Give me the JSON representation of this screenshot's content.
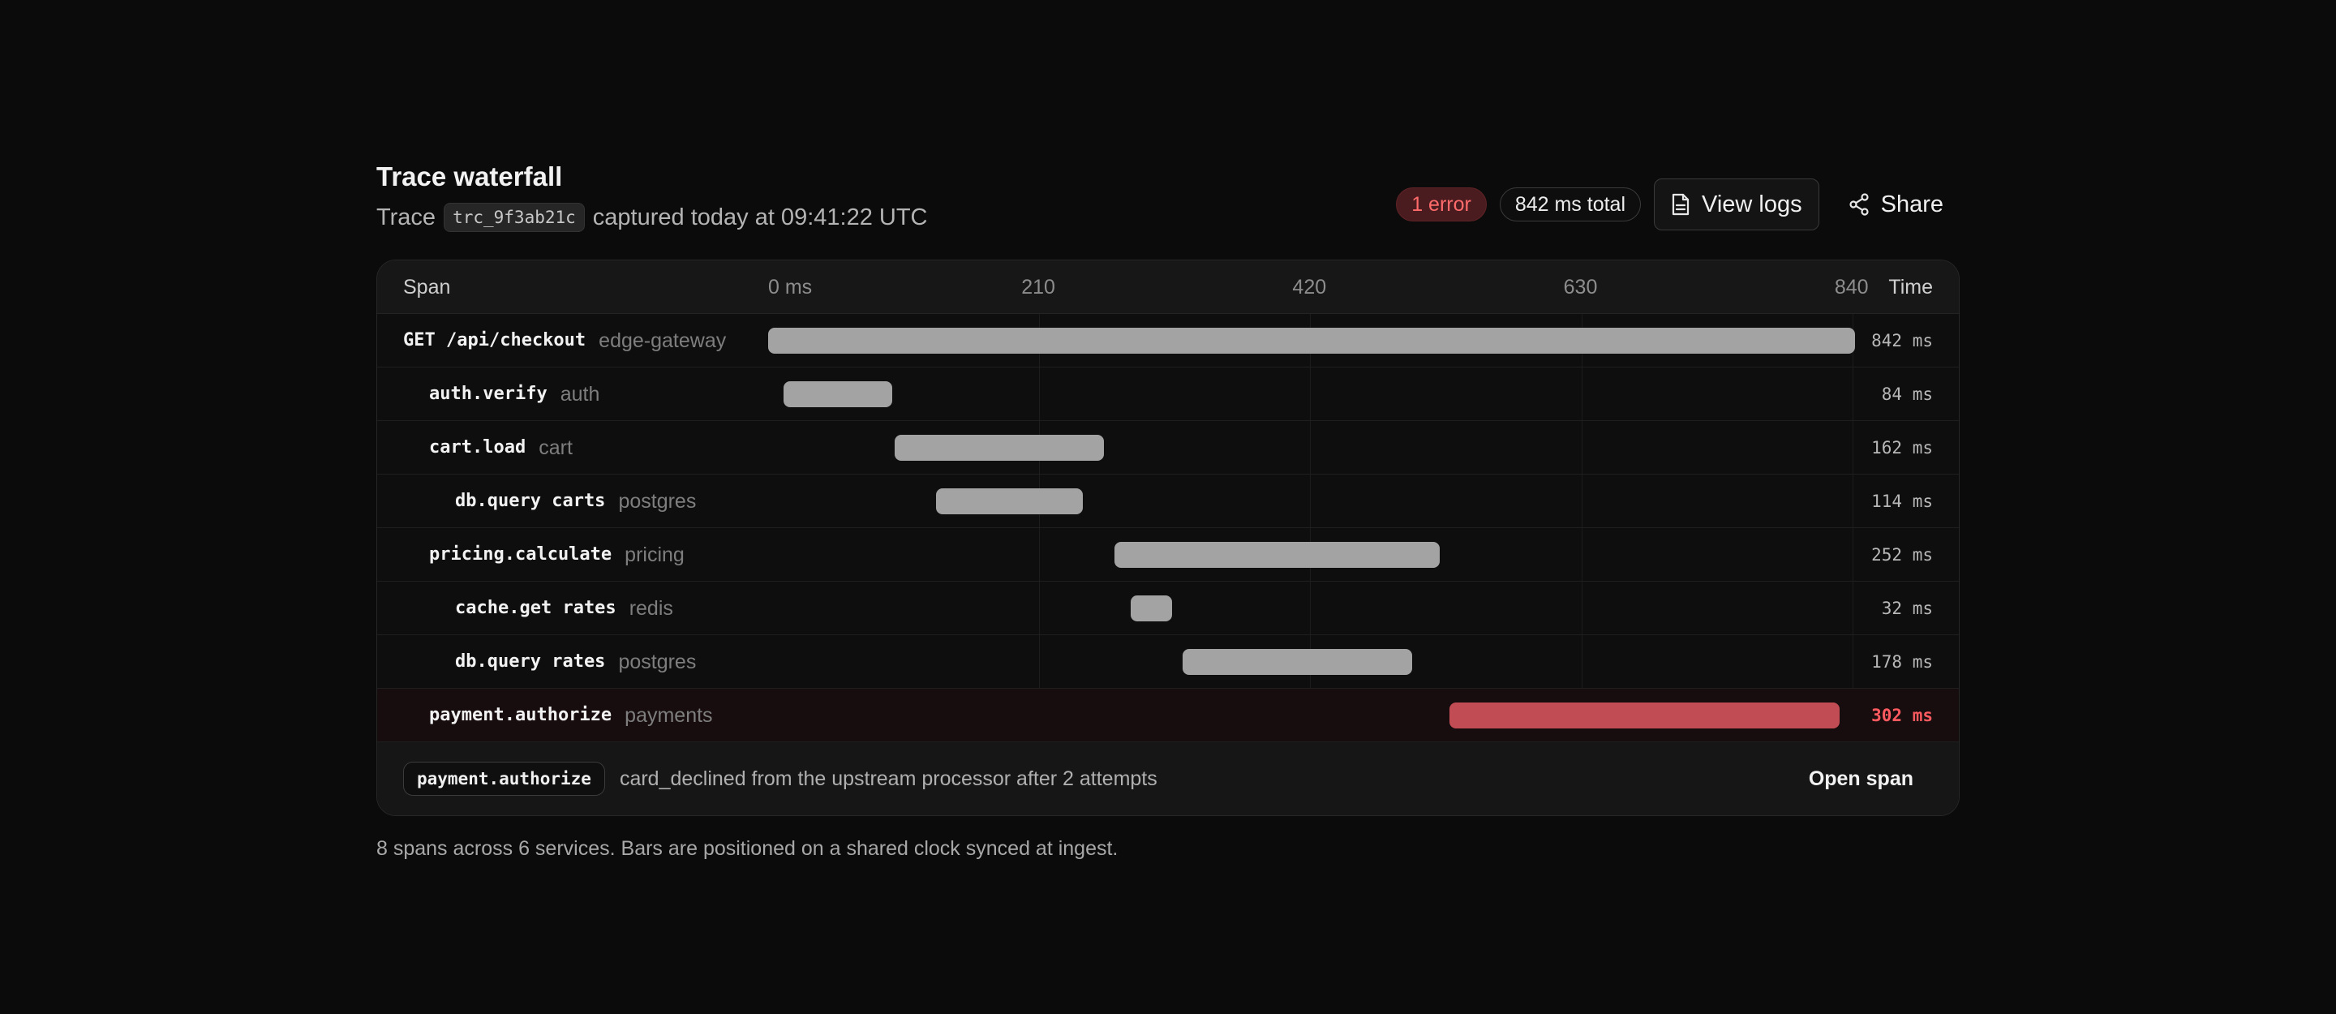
{
  "header": {
    "title": "Trace waterfall",
    "trace_prefix": "Trace",
    "trace_id": "trc_9f3ab21c",
    "captured": "captured today at 09:41:22 UTC",
    "error_badge": "1 error",
    "total_badge": "842 ms total",
    "view_logs_label": "View logs",
    "share_label": "Share",
    "view_logs_icon": "file-text-icon",
    "share_icon": "share-icon"
  },
  "table": {
    "col_span": "Span",
    "col_time": "Time",
    "ticks": [
      "0 ms",
      "210",
      "420",
      "630",
      "840"
    ],
    "scale_max_ms": 842
  },
  "chart_data": {
    "type": "bar",
    "title": "",
    "unit": "ms",
    "x_ticks": [
      0,
      210,
      420,
      630,
      840
    ],
    "rows": [
      {
        "name": "GET /api/checkout",
        "service": "edge-gateway",
        "depth": 0,
        "start_ms": 0,
        "duration_ms": 842,
        "duration_label": "842 ms",
        "error": false
      },
      {
        "name": "auth.verify",
        "service": "auth",
        "depth": 1,
        "start_ms": 12,
        "duration_ms": 84,
        "duration_label": "84 ms",
        "error": false
      },
      {
        "name": "cart.load",
        "service": "cart",
        "depth": 1,
        "start_ms": 98,
        "duration_ms": 162,
        "duration_label": "162 ms",
        "error": false
      },
      {
        "name": "db.query carts",
        "service": "postgres",
        "depth": 2,
        "start_ms": 130,
        "duration_ms": 114,
        "duration_label": "114 ms",
        "error": false
      },
      {
        "name": "pricing.calculate",
        "service": "pricing",
        "depth": 1,
        "start_ms": 268,
        "duration_ms": 252,
        "duration_label": "252 ms",
        "error": false
      },
      {
        "name": "cache.get rates",
        "service": "redis",
        "depth": 2,
        "start_ms": 281,
        "duration_ms": 32,
        "duration_label": "32 ms",
        "error": false
      },
      {
        "name": "db.query rates",
        "service": "postgres",
        "depth": 2,
        "start_ms": 321,
        "duration_ms": 178,
        "duration_label": "178 ms",
        "error": false
      },
      {
        "name": "payment.authorize",
        "service": "payments",
        "depth": 1,
        "start_ms": 528,
        "duration_ms": 302,
        "duration_label": "302 ms",
        "error": true
      }
    ],
    "colors": {
      "bar": "#a3a3a3",
      "error_bar": "#c24c53"
    }
  },
  "footer": {
    "span_chip": "payment.authorize",
    "message": "card_declined from the upstream processor after 2 attempts",
    "open_span_label": "Open span"
  },
  "note": "8 spans across 6 services. Bars are positioned on a shared clock synced at ingest."
}
